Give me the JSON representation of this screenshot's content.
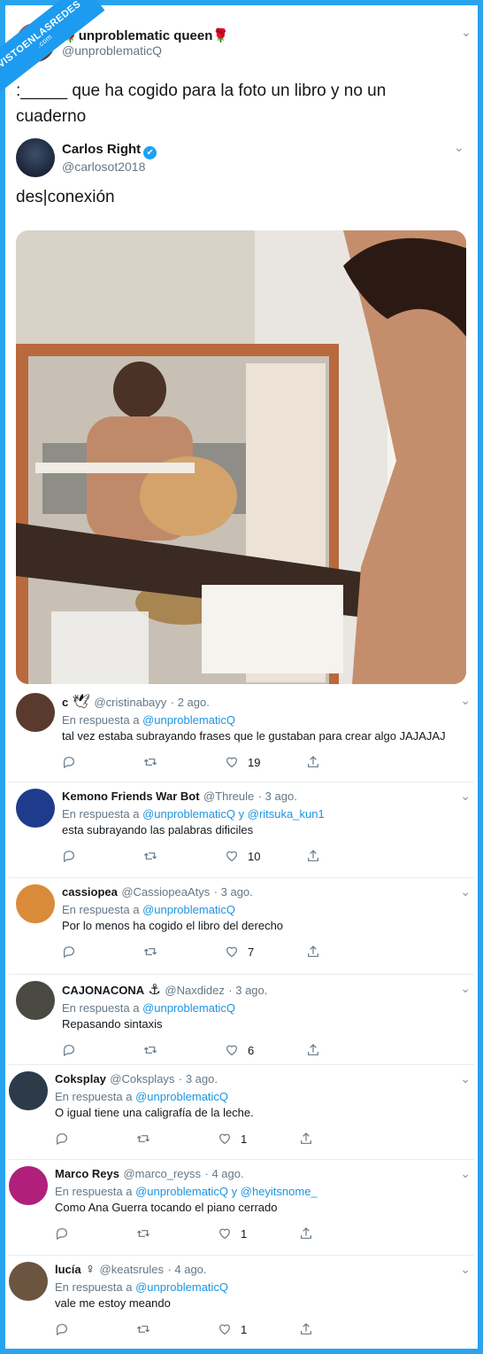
{
  "watermark": {
    "line1": "VISTOENLASREDES",
    "line2": ".com"
  },
  "main_tweet": {
    "name": "unproblematic queen",
    "name_emoji_left": "🌹",
    "name_emoji_right": "🌹",
    "handle": "@unproblematicQ",
    "text": ":_____ que ha cogido para la foto un libro y no un cuaderno"
  },
  "quoted_tweet": {
    "name": "Carlos Right",
    "verified_icon": "✔",
    "handle": "@carlosot2018",
    "text": "des|conexión"
  },
  "replies": [
    {
      "name": "c",
      "name_emoji": "🕊",
      "handle": "@cristinabayy",
      "date": "· 2 ago.",
      "reply_prefix": "En respuesta a",
      "mentions": "@unproblematicQ",
      "text": "tal vez estaba subrayando frases que le gustaban para crear algo JAJAJAJ",
      "likes": "19",
      "avatar_color": "#5b3a2e"
    },
    {
      "name": "Kemono Friends War Bot",
      "handle": "@Threule",
      "date": "· 3 ago.",
      "reply_prefix": "En respuesta a",
      "mentions": "@unproblematicQ y @ritsuka_kun1",
      "text": "esta subrayando las palabras dificiles",
      "likes": "10",
      "avatar_color": "#1f3b8c"
    },
    {
      "name": "cassiopea",
      "handle": "@CassiopeaAtys",
      "date": "· 3 ago.",
      "reply_prefix": "En respuesta a",
      "mentions": "@unproblematicQ",
      "text": "Por lo menos ha cogido el libro del derecho",
      "likes": "7",
      "avatar_color": "#d98b3a"
    },
    {
      "name": "CAJONACONA",
      "name_emoji": "⚓",
      "handle": "@Naxdidez",
      "date": "· 3 ago.",
      "reply_prefix": "En respuesta a",
      "mentions": "@unproblematicQ",
      "text": "Repasando sintaxis",
      "likes": "6",
      "avatar_color": "#4a4a42"
    },
    {
      "name": "Coksplay",
      "handle": "@Coksplays",
      "date": "· 3 ago.",
      "reply_prefix": "En respuesta a",
      "mentions": "@unproblematicQ",
      "text": "O igual tiene una caligrafía de la leche.",
      "likes": "1",
      "avatar_color": "#2c3a4a"
    },
    {
      "name": "Marco Reys",
      "handle": "@marco_reyss",
      "date": "· 4 ago.",
      "reply_prefix": "En respuesta a",
      "mentions": "@unproblematicQ y @heyitsnome_",
      "text": "Como Ana Guerra tocando el piano cerrado",
      "likes": "1",
      "avatar_color": "#b0207a"
    },
    {
      "name": "lucía",
      "name_emoji": "♀",
      "handle": "@keatsrules",
      "date": "· 4 ago.",
      "reply_prefix": "En respuesta a",
      "mentions": "@unproblematicQ",
      "text": "vale me estoy meando",
      "likes": "1",
      "avatar_color": "#6b5540"
    }
  ],
  "icons": {
    "reply": "reply-icon",
    "retweet": "retweet-icon",
    "like": "heart-icon",
    "share": "share-icon",
    "more": "chevron-down-icon"
  },
  "colors": {
    "link": "#1b95e0",
    "frame": "#2aa3ef",
    "secondary_text": "#657786"
  }
}
